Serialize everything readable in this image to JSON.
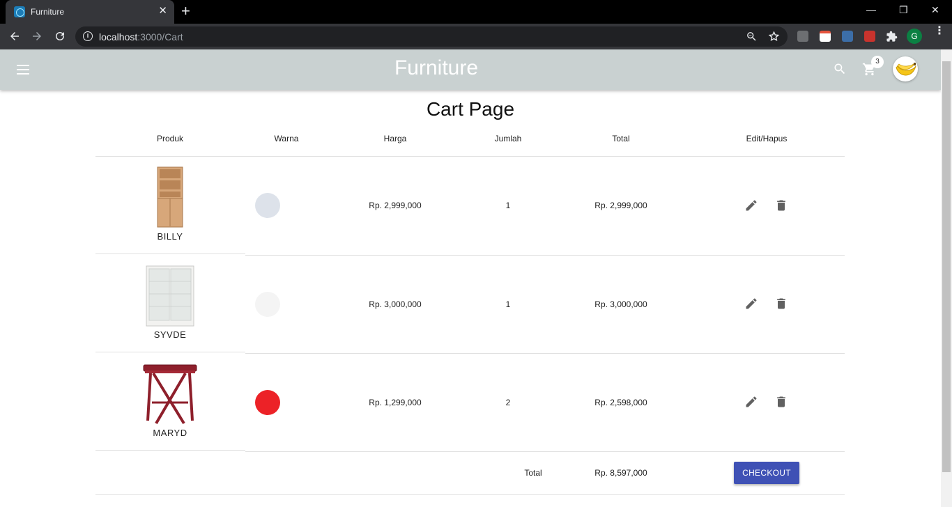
{
  "browser": {
    "tab_title": "Furniture",
    "tab_close": "✕",
    "new_tab": "+",
    "url_host": "localhost",
    "url_rest": ":3000/Cart",
    "profile_initial": "G",
    "min": "—",
    "restore": "❐",
    "close": "✕"
  },
  "app": {
    "title": "Furniture",
    "cart_count": "3",
    "page_title": "Cart Page"
  },
  "table": {
    "headers": [
      "Produk",
      "Warna",
      "Harga",
      "Jumlah",
      "Total",
      "Edit/Hapus"
    ],
    "rows": [
      {
        "name": "BILLY",
        "color": "#dde2ea",
        "price": "Rp. 2,999,000",
        "qty": "1",
        "total": "Rp. 2,999,000"
      },
      {
        "name": "SYVDE",
        "color": "#f4f4f4",
        "price": "Rp. 3,000,000",
        "qty": "1",
        "total": "Rp. 3,000,000"
      },
      {
        "name": "MARYD",
        "color": "#ec2227",
        "price": "Rp. 1,299,000",
        "qty": "2",
        "total": "Rp. 2,598,000"
      }
    ],
    "total_label": "Total",
    "grand_total": "Rp. 8,597,000",
    "checkout_label": "CHECKOUT"
  }
}
